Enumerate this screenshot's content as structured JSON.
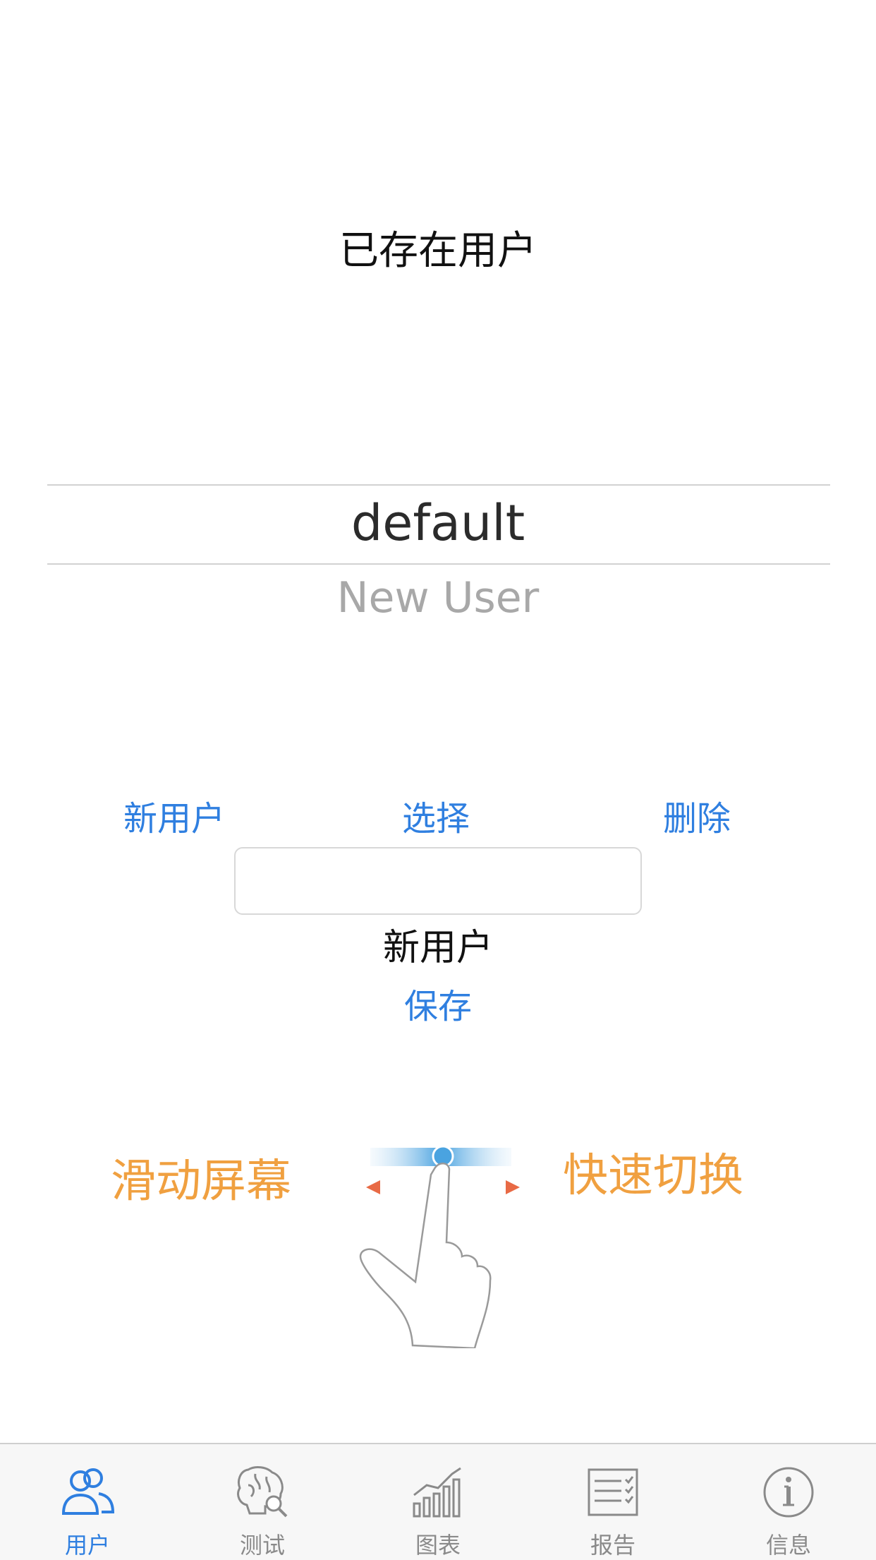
{
  "page": {
    "title": "已存在用户"
  },
  "picker": {
    "selected": "default",
    "next": "New User"
  },
  "actions": {
    "new_label": "新用户",
    "select_label": "选择",
    "delete_label": "删除"
  },
  "form": {
    "input_value": "",
    "input_label": "新用户",
    "save_label": "保存"
  },
  "hint": {
    "left_text": "滑动屏幕",
    "right_text": "快速切换",
    "color": "#f0a040"
  },
  "tabs": [
    {
      "label": "用户",
      "icon": "users-icon",
      "active": true
    },
    {
      "label": "测试",
      "icon": "brain-search-icon",
      "active": false
    },
    {
      "label": "图表",
      "icon": "bar-chart-icon",
      "active": false
    },
    {
      "label": "报告",
      "icon": "report-checklist-icon",
      "active": false
    },
    {
      "label": "信息",
      "icon": "info-icon",
      "active": false
    }
  ],
  "colors": {
    "accent": "#2f7fe0",
    "inactive": "#8a8a8a"
  }
}
